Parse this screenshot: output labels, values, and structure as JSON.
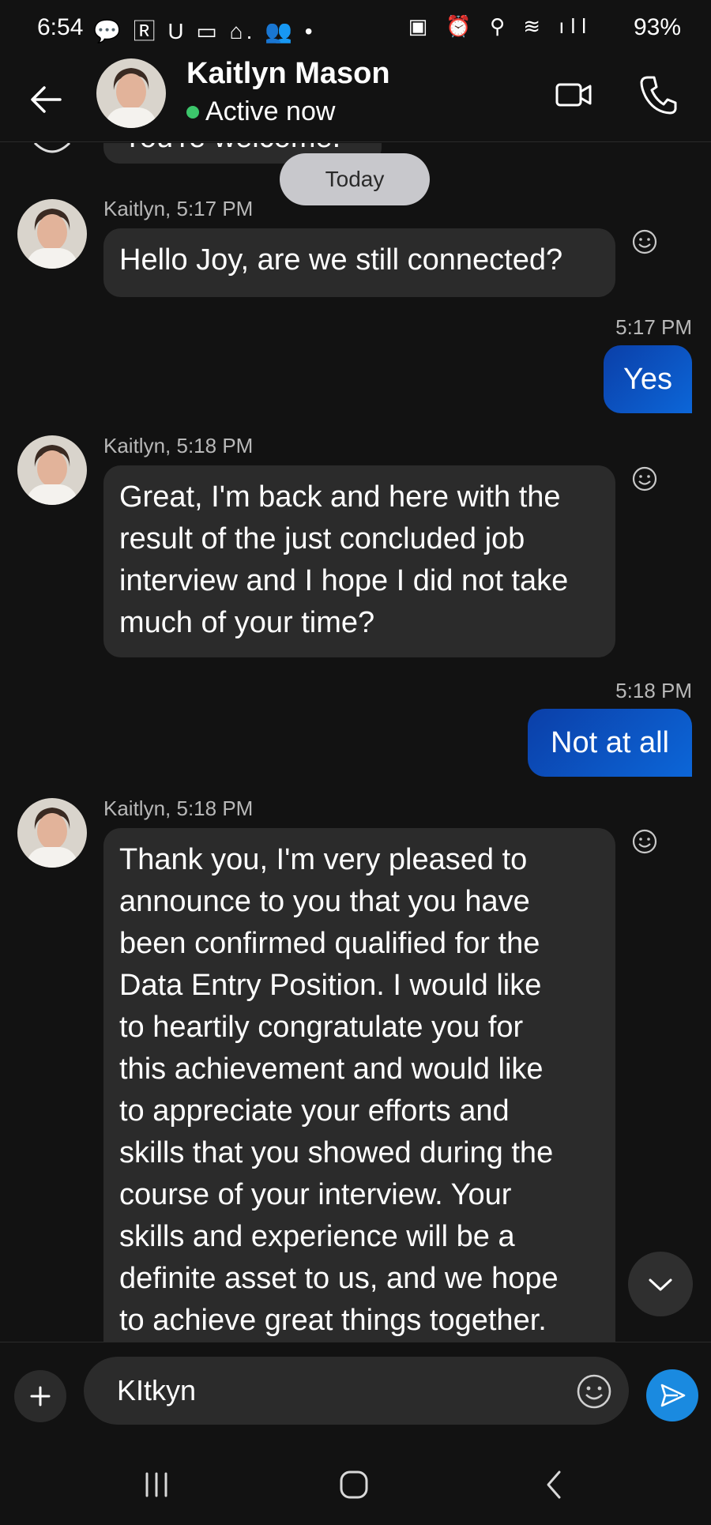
{
  "status_bar": {
    "time": "6:54",
    "left_icons": "💬 🅁 U ▭ ⌂. 👥 •",
    "right_icons": "▣ ⏰ ⚲ ≋ ıll",
    "battery": "93%"
  },
  "header": {
    "contact_name": "Kaitlyn Mason",
    "presence": "Active now",
    "presence_color": "#3cc66b"
  },
  "chat": {
    "partial_message": "You're welcome.",
    "date_separator": "Today",
    "messages": [
      {
        "direction": "in",
        "meta": "Kaitlyn, 5:17 PM",
        "text": "Hello Joy, are we still connected?"
      },
      {
        "direction": "out",
        "time": "5:17 PM",
        "text": "Yes"
      },
      {
        "direction": "in",
        "meta": "Kaitlyn, 5:18 PM",
        "lines": [
          "Great, I'm back and here with the",
          "result of the just concluded job",
          "interview and I hope I did not take",
          "much of your time?"
        ]
      },
      {
        "direction": "out",
        "time": "5:18 PM",
        "text": "Not at all"
      },
      {
        "direction": "in",
        "meta": "Kaitlyn, 5:18 PM",
        "lines": [
          "Thank you, I'm very pleased to",
          "announce to you that you have",
          "been confirmed qualified for the",
          "Data Entry Position. I would like",
          "to heartily congratulate you for",
          "this achievement and would like",
          "to appreciate your efforts and",
          "skills that you showed during the",
          "course of your interview. Your",
          "skills and experience will be a",
          "definite asset to us, and we hope",
          "to achieve great things together."
        ]
      }
    ]
  },
  "composer": {
    "input_value": "KItkyn"
  },
  "colors": {
    "background": "#121212",
    "incoming_bubble": "#2b2b2b",
    "outgoing_bubble_start": "#0b3fa8",
    "outgoing_bubble_end": "#0c66d8",
    "send_button": "#1a8ae0"
  },
  "icons": {
    "back": "arrow-left-icon",
    "video": "video-camera-icon",
    "call": "phone-icon",
    "react": "smiley-icon",
    "add": "plus-icon",
    "emoji": "emoji-icon",
    "send": "send-icon",
    "scroll": "chevron-down-icon"
  }
}
